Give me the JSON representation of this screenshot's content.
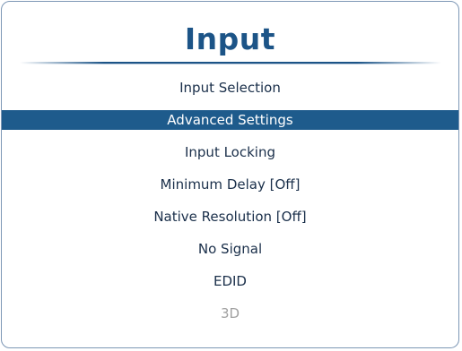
{
  "title": "Input",
  "menu": {
    "items": [
      {
        "label": "Input Selection",
        "state": "normal"
      },
      {
        "label": "Advanced Settings",
        "state": "selected"
      },
      {
        "label": "Input Locking",
        "state": "normal"
      },
      {
        "label": "Minimum Delay [Off]",
        "state": "normal"
      },
      {
        "label": "Native Resolution [Off]",
        "state": "normal"
      },
      {
        "label": "No Signal",
        "state": "normal"
      },
      {
        "label": "EDID",
        "state": "normal"
      },
      {
        "label": "3D",
        "state": "disabled"
      }
    ]
  },
  "colors": {
    "accent": "#1e5b8c",
    "title": "#1c5487",
    "text": "#1a2f4a",
    "disabled_text": "#a0a0a0",
    "frame_border": "#7d97b5"
  }
}
